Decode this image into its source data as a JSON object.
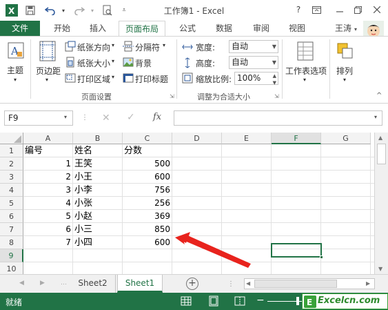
{
  "titlebar": {
    "title": "工作簿1 - Excel",
    "help": "?",
    "colors": {
      "excel_green": "#217346"
    }
  },
  "tabs": [
    {
      "label": "文件"
    },
    {
      "label": "开始"
    },
    {
      "label": "插入"
    },
    {
      "label": "页面布局"
    },
    {
      "label": "公式"
    },
    {
      "label": "数据"
    },
    {
      "label": "审阅"
    },
    {
      "label": "视图"
    }
  ],
  "user": {
    "name": "王涛"
  },
  "ribbon": {
    "themes": {
      "label": "主题",
      "group": ""
    },
    "page_setup": {
      "margins": "页边距",
      "orientation": "纸张方向",
      "size": "纸张大小",
      "print_area": "打印区域",
      "breaks": "分隔符",
      "background": "背景",
      "print_titles": "打印标题",
      "group_label": "页面设置"
    },
    "scale": {
      "width_label": "宽度:",
      "width_value": "自动",
      "height_label": "高度:",
      "height_value": "自动",
      "scale_label": "缩放比例:",
      "scale_value": "100%",
      "group_label": "调整为合适大小"
    },
    "sheet_options": {
      "label": "工作表选项"
    },
    "arrange": {
      "label": "排列"
    }
  },
  "formula_bar": {
    "name_box": "F9",
    "fx": "fx",
    "value": ""
  },
  "grid": {
    "columns": [
      "A",
      "B",
      "C",
      "D",
      "E",
      "F",
      "G"
    ],
    "rows": [
      "1",
      "2",
      "3",
      "4",
      "5",
      "6",
      "7",
      "8",
      "9",
      "10"
    ],
    "cells": [
      [
        "编号",
        "姓名",
        "分数"
      ],
      [
        "1",
        "王笑",
        "500"
      ],
      [
        "2",
        "小王",
        "600"
      ],
      [
        "3",
        "小李",
        "756"
      ],
      [
        "4",
        "小张",
        "256"
      ],
      [
        "5",
        "小赵",
        "369"
      ],
      [
        "6",
        "小三",
        "850"
      ],
      [
        "7",
        "小四",
        "600"
      ]
    ],
    "selected_cell": "F9",
    "arrow_color": "#e8231d"
  },
  "sheets": [
    {
      "name": "Sheet2",
      "active": false
    },
    {
      "name": "Sheet1",
      "active": true
    }
  ],
  "status": {
    "mode": "就绪",
    "watermark": "Excelcn.com"
  }
}
